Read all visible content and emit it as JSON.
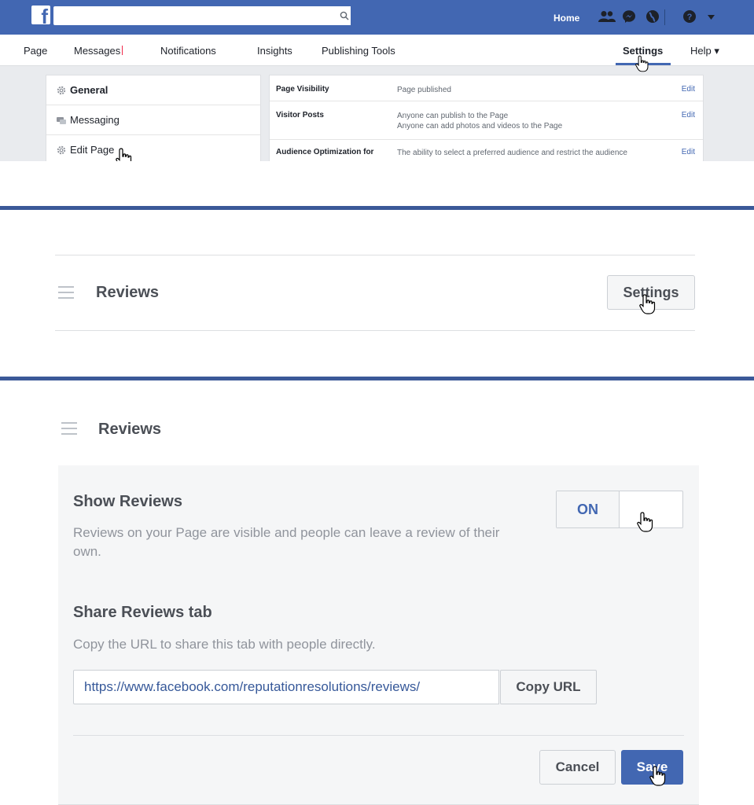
{
  "panel1": {
    "search": {
      "placeholder": ""
    },
    "topbar": {
      "home": "Home"
    },
    "nav": {
      "page": "Page",
      "messages": "Messages",
      "notifications": "Notifications",
      "insights": "Insights",
      "publishing_tools": "Publishing Tools",
      "settings": "Settings",
      "help": "Help ▾"
    },
    "sidebar": {
      "items": [
        {
          "label": "General"
        },
        {
          "label": "Messaging"
        },
        {
          "label": "Edit Page"
        }
      ]
    },
    "settings_rows": [
      {
        "key": "Page Visibility",
        "value_lines": [
          "Page published"
        ],
        "edit": "Edit"
      },
      {
        "key": "Visitor Posts",
        "value_lines": [
          "Anyone can publish to the Page",
          "Anyone can add photos and videos to the Page"
        ],
        "edit": "Edit"
      },
      {
        "key": "Audience Optimization for",
        "value_lines": [
          "The ability to select a preferred audience and restrict the audience"
        ],
        "edit": "Edit"
      }
    ]
  },
  "panel2": {
    "title": "Reviews",
    "settings_button": "Settings"
  },
  "panel3": {
    "title": "Reviews",
    "show_reviews": {
      "heading": "Show Reviews",
      "description": "Reviews on your Page are visible and people can leave a review of their own.",
      "toggle_state": "ON"
    },
    "share_tab": {
      "heading": "Share Reviews tab",
      "description": "Copy the URL to share this tab with people directly.",
      "url": "https://www.facebook.com/reputationresolutions/reviews/",
      "copy_button": "Copy URL"
    },
    "actions": {
      "cancel": "Cancel",
      "save": "Save"
    }
  },
  "colors": {
    "facebook_blue": "#4267b2",
    "divider_blue": "#3b5998",
    "muted_text": "#90949c",
    "panel_bg": "#f5f6f7"
  },
  "icons": [
    "facebook-logo-icon",
    "search-icon",
    "friends-icon",
    "messenger-icon",
    "globe-icon",
    "help-icon",
    "caret-down-icon",
    "gear-icon",
    "chat-icon",
    "hamburger-icon",
    "hand-cursor-icon"
  ]
}
